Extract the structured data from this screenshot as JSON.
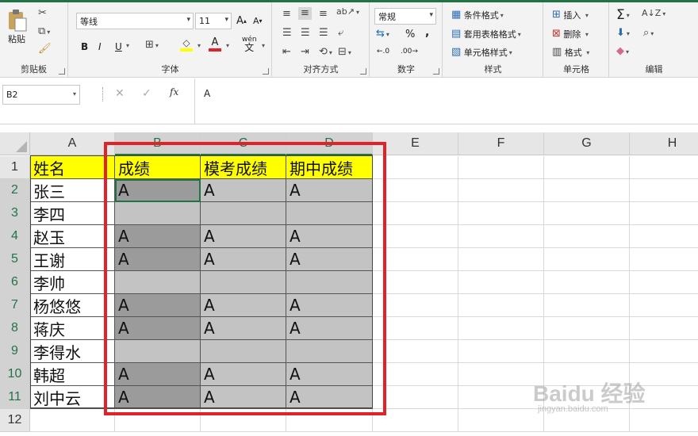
{
  "ribbon": {
    "clipboard": {
      "label": "剪贴板",
      "paste": "粘贴"
    },
    "font": {
      "label": "字体",
      "name": "等线",
      "size": "11",
      "bold": "B",
      "italic": "I",
      "underline": "U",
      "phonetic": "wén",
      "phonetic2": "文"
    },
    "align": {
      "label": "对齐方式"
    },
    "number": {
      "label": "数字",
      "format": "常规",
      "pct": "%",
      "comma": ","
    },
    "styles": {
      "label": "样式",
      "cond": "条件格式",
      "table": "套用表格格式",
      "cell": "单元格样式"
    },
    "cells": {
      "label": "单元格",
      "insert": "插入",
      "delete": "删除",
      "format": "格式"
    },
    "edit": {
      "label": "编辑"
    }
  },
  "formula_bar": {
    "name_box": "B2",
    "fx": "fx",
    "value": "A"
  },
  "columns": [
    "A",
    "B",
    "C",
    "D",
    "E",
    "F",
    "G",
    "H"
  ],
  "rows": [
    "1",
    "2",
    "3",
    "4",
    "5",
    "6",
    "7",
    "8",
    "9",
    "10",
    "11",
    "12"
  ],
  "sheet": {
    "headers": [
      "姓名",
      "成绩",
      "模考成绩",
      "期中成绩"
    ],
    "data": [
      [
        "张三",
        "A",
        "A",
        "A"
      ],
      [
        "李四",
        "",
        "",
        ""
      ],
      [
        "赵玉",
        "A",
        "A",
        "A"
      ],
      [
        "王谢",
        "A",
        "A",
        "A"
      ],
      [
        "李帅",
        "",
        "",
        ""
      ],
      [
        "杨悠悠",
        "A",
        "A",
        "A"
      ],
      [
        "蒋庆",
        "A",
        "A",
        "A"
      ],
      [
        "李得水",
        "",
        "",
        ""
      ],
      [
        "韩超",
        "A",
        "A",
        "A"
      ],
      [
        "刘中云",
        "A",
        "A",
        "A"
      ]
    ]
  },
  "watermark": {
    "logo": "Baidu 经验",
    "url": "jingyan.baidu.com"
  },
  "colors": {
    "accent": "#217346",
    "header_fill": "#ffff00",
    "light_fill": "#c3c3c3",
    "dark_fill": "#9b9b9b",
    "highlight": "#e0222a"
  }
}
